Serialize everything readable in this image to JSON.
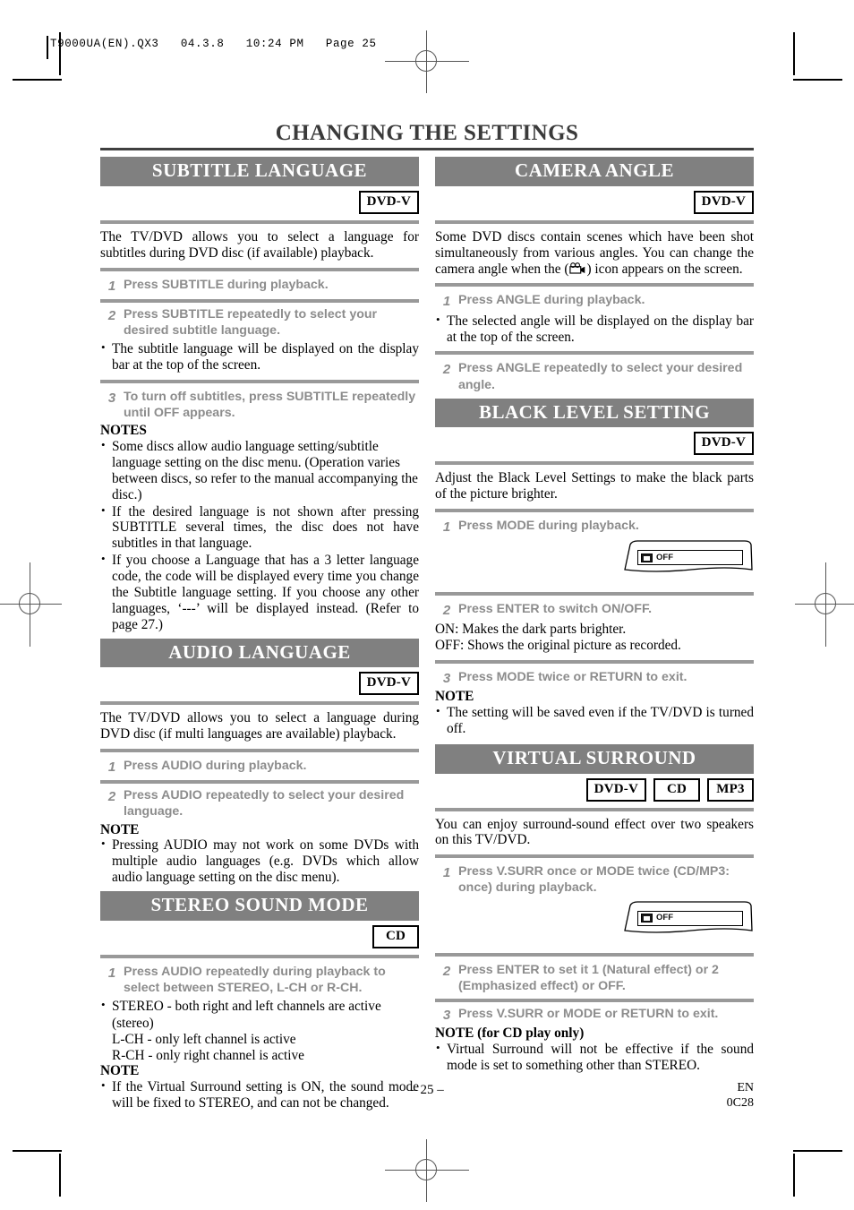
{
  "header": {
    "text": "T9000UA(EN).QX3   04.3.8   10:24 PM   Page 25"
  },
  "page_title": "CHANGING THE SETTINGS",
  "left_column": {
    "sections": [
      {
        "banner": "SUBTITLE LANGUAGE",
        "badges": [
          "DVD-V"
        ],
        "intro": "The TV/DVD allows you to select a language for subtitles during DVD disc (if available) playback.",
        "steps": [
          {
            "num": "1",
            "text": "Press SUBTITLE during playback."
          },
          {
            "num": "2",
            "text": "Press SUBTITLE repeatedly to select your desired subtitle language."
          },
          {
            "num": "3",
            "text": "To turn off subtitles, press SUBTITLE repeatedly until OFF appears."
          }
        ],
        "step2_bullet": "The subtitle language will be displayed on the display bar at the top of the screen.",
        "note_head": "NOTES",
        "notes": [
          "Some discs allow audio language setting/subtitle language setting on the disc menu. (Operation varies between discs, so refer to the manual accompanying the disc.)",
          "If the desired language is not shown after pressing SUBTITLE several times, the disc does not have subtitles in that language.",
          "If you choose a Language that has a 3 letter language code, the code will be displayed every time you change the Subtitle language setting. If you choose any other languages, ‘---’ will be displayed instead. (Refer to page 27.)"
        ]
      },
      {
        "banner": "AUDIO LANGUAGE",
        "badges": [
          "DVD-V"
        ],
        "intro": "The TV/DVD allows you to select a language during DVD disc (if multi languages are available) playback.",
        "steps": [
          {
            "num": "1",
            "text": "Press AUDIO during playback."
          },
          {
            "num": "2",
            "text": "Press AUDIO repeatedly to select your desired language."
          }
        ],
        "note_head": "NOTE",
        "notes": [
          "Pressing AUDIO may not work on some DVDs with multiple audio languages (e.g. DVDs which allow audio language setting on the disc menu)."
        ]
      },
      {
        "banner": "STEREO SOUND MODE",
        "badges": [
          "CD"
        ],
        "steps": [
          {
            "num": "1",
            "text": "Press AUDIO repeatedly during playback to select between STEREO, L-CH or R-CH."
          }
        ],
        "channel_bullet": "STEREO - both right and left channels are active",
        "channel_lines": [
          "(stereo)",
          "L-CH - only left channel is active",
          "R-CH - only right channel is active"
        ],
        "note_head": "NOTE",
        "notes": [
          "If the Virtual Surround setting is ON, the sound mode will be fixed to STEREO, and can not be changed."
        ]
      }
    ]
  },
  "right_column": {
    "sections": [
      {
        "banner": "CAMERA ANGLE",
        "badges": [
          "DVD-V"
        ],
        "intro_part1": "Some DVD discs contain scenes which have been shot simultaneously from various angles. You can change the camera angle when the (",
        "intro_icon": "camera-angle-icon",
        "intro_part2": ") icon appears on the screen.",
        "steps": [
          {
            "num": "1",
            "text": "Press ANGLE during playback."
          },
          {
            "num": "2",
            "text": "Press ANGLE repeatedly to select your desired angle."
          }
        ],
        "step1_bullet": "The selected angle will be displayed on the display bar at the top of the screen."
      },
      {
        "banner": "BLACK LEVEL SETTING",
        "badges": [
          "DVD-V"
        ],
        "intro": "Adjust the Black Level Settings to make the black parts of the picture brighter.",
        "steps": [
          {
            "num": "1",
            "text": "Press MODE during playback."
          },
          {
            "num": "2",
            "text": "Press ENTER to switch ON/OFF."
          },
          {
            "num": "3",
            "text": "Press MODE twice or RETURN to exit."
          }
        ],
        "osd": {
          "label": "OFF"
        },
        "onoff_lines": [
          "ON: Makes the dark parts brighter.",
          "OFF: Shows the original picture as recorded."
        ],
        "note_head": "NOTE",
        "notes": [
          "The setting will be saved even if the TV/DVD is turned off."
        ]
      },
      {
        "banner": "VIRTUAL SURROUND",
        "badges": [
          "DVD-V",
          "CD",
          "MP3"
        ],
        "intro": "You can enjoy surround-sound effect over two speakers on this TV/DVD.",
        "steps": [
          {
            "num": "1",
            "text": "Press V.SURR once or MODE twice (CD/MP3: once) during playback."
          },
          {
            "num": "2",
            "text": "Press ENTER to set it 1 (Natural effect) or 2 (Emphasized effect) or OFF."
          },
          {
            "num": "3",
            "text": "Press V.SURR or MODE or RETURN to exit."
          }
        ],
        "osd": {
          "label": "OFF"
        },
        "note_head": "NOTE (for CD play only)",
        "notes": [
          "Virtual Surround will not be effective if the sound mode is set to something other than STEREO."
        ]
      }
    ]
  },
  "footer": {
    "page_number": "– 25 –",
    "language_code": "EN",
    "doc_code": "0C28"
  }
}
